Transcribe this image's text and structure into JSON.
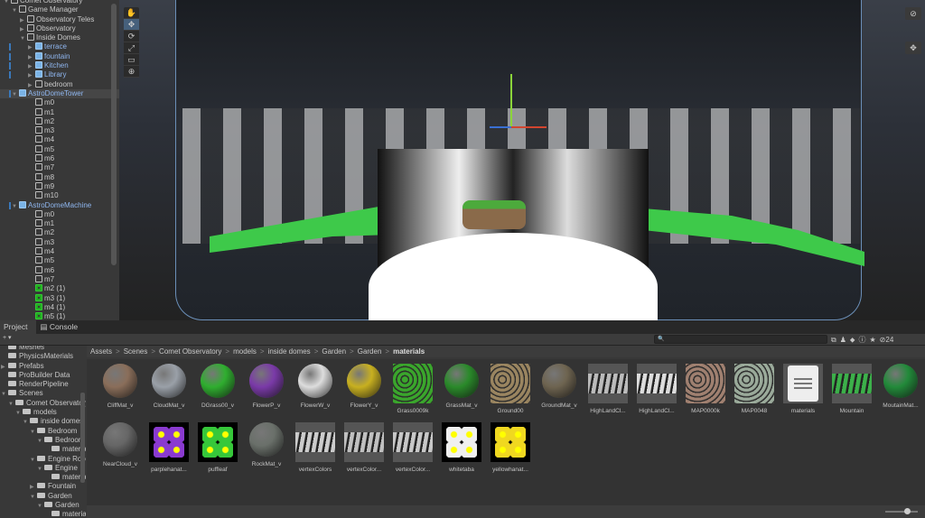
{
  "hierarchy": {
    "items": [
      {
        "label": "Comet Observatory",
        "indent": 0,
        "tri": "▼",
        "type": "scene"
      },
      {
        "label": "Game Manager",
        "indent": 1,
        "tri": "▼",
        "type": "obj"
      },
      {
        "label": "Observatory Teles",
        "indent": 2,
        "tri": "▶",
        "type": "obj"
      },
      {
        "label": "Observatory",
        "indent": 2,
        "tri": "▶",
        "type": "obj"
      },
      {
        "label": "Inside Domes",
        "indent": 2,
        "tri": "▼",
        "type": "obj"
      },
      {
        "label": "terrace",
        "indent": 3,
        "tri": "▶",
        "type": "prefab"
      },
      {
        "label": "fountain",
        "indent": 3,
        "tri": "▶",
        "type": "prefab"
      },
      {
        "label": "Kitchen",
        "indent": 3,
        "tri": "▶",
        "type": "prefab"
      },
      {
        "label": "Library",
        "indent": 3,
        "tri": "▶",
        "type": "prefab"
      },
      {
        "label": "bedroom",
        "indent": 3,
        "tri": "▶",
        "type": "obj"
      },
      {
        "label": "AstroDomeTower",
        "indent": 1,
        "tri": "▼",
        "type": "prefab",
        "sel": true
      },
      {
        "label": "m0",
        "indent": 3,
        "type": "obj"
      },
      {
        "label": "m1",
        "indent": 3,
        "type": "obj"
      },
      {
        "label": "m2",
        "indent": 3,
        "type": "obj"
      },
      {
        "label": "m3",
        "indent": 3,
        "type": "obj"
      },
      {
        "label": "m4",
        "indent": 3,
        "type": "obj"
      },
      {
        "label": "m5",
        "indent": 3,
        "type": "obj"
      },
      {
        "label": "m6",
        "indent": 3,
        "type": "obj"
      },
      {
        "label": "m7",
        "indent": 3,
        "type": "obj"
      },
      {
        "label": "m8",
        "indent": 3,
        "type": "obj"
      },
      {
        "label": "m9",
        "indent": 3,
        "type": "obj"
      },
      {
        "label": "m10",
        "indent": 3,
        "type": "obj"
      },
      {
        "label": "AstroDomeMachine",
        "indent": 1,
        "tri": "▼",
        "type": "prefab"
      },
      {
        "label": "m0",
        "indent": 3,
        "type": "obj"
      },
      {
        "label": "m1",
        "indent": 3,
        "type": "obj"
      },
      {
        "label": "m2",
        "indent": 3,
        "type": "obj"
      },
      {
        "label": "m3",
        "indent": 3,
        "type": "obj"
      },
      {
        "label": "m4",
        "indent": 3,
        "type": "obj"
      },
      {
        "label": "m5",
        "indent": 3,
        "type": "obj"
      },
      {
        "label": "m6",
        "indent": 3,
        "type": "obj"
      },
      {
        "label": "m7",
        "indent": 3,
        "type": "obj"
      },
      {
        "label": "m2 (1)",
        "indent": 3,
        "type": "added"
      },
      {
        "label": "m3 (1)",
        "indent": 3,
        "type": "added"
      },
      {
        "label": "m4 (1)",
        "indent": 3,
        "type": "added"
      },
      {
        "label": "m5 (1)",
        "indent": 3,
        "type": "added"
      }
    ]
  },
  "scene_tools": [
    "✋",
    "✥",
    "⟳",
    "⤢",
    "▭",
    "⊕"
  ],
  "tabs": [
    {
      "label": "Project",
      "icon": "folder-icon"
    },
    {
      "label": "Console",
      "icon": "console-icon"
    }
  ],
  "search": {
    "placeholder": "🔍"
  },
  "hidden_count": "24",
  "tree": [
    {
      "label": "Meshes",
      "indent": 0
    },
    {
      "label": "PhysicsMaterials",
      "indent": 0
    },
    {
      "label": "Prefabs",
      "indent": 0,
      "tri": "▶"
    },
    {
      "label": "ProBuilder Data",
      "indent": 0
    },
    {
      "label": "RenderPipeline",
      "indent": 0
    },
    {
      "label": "Scenes",
      "indent": 0,
      "tri": "▼"
    },
    {
      "label": "Comet Observatory",
      "indent": 1,
      "tri": "▼"
    },
    {
      "label": "models",
      "indent": 2,
      "tri": "▼"
    },
    {
      "label": "inside domes",
      "indent": 3,
      "tri": "▼"
    },
    {
      "label": "Bedroom",
      "indent": 4,
      "tri": "▼"
    },
    {
      "label": "Bedroom",
      "indent": 5,
      "tri": "▼"
    },
    {
      "label": "materials",
      "indent": 6
    },
    {
      "label": "Engine Room",
      "indent": 4,
      "tri": "▼"
    },
    {
      "label": "Engine",
      "indent": 5,
      "tri": "▼"
    },
    {
      "label": "materials",
      "indent": 6
    },
    {
      "label": "Fountain",
      "indent": 4,
      "tri": "▶"
    },
    {
      "label": "Garden",
      "indent": 4,
      "tri": "▼"
    },
    {
      "label": "Garden",
      "indent": 5,
      "tri": "▼"
    },
    {
      "label": "materials",
      "indent": 6
    }
  ],
  "breadcrumb": [
    "Assets",
    "Scenes",
    "Comet Observatory",
    "models",
    "inside domes",
    "Garden",
    "Garden",
    "materials"
  ],
  "assets": [
    {
      "label": "CliffMat_v",
      "kind": "sphere",
      "color": "#8a6e5a"
    },
    {
      "label": "CloudMat_v",
      "kind": "sphere",
      "color": "#9aa0a8"
    },
    {
      "label": "DGrass00_v",
      "kind": "sphere",
      "color": "#2fae2f"
    },
    {
      "label": "FlowerP_v",
      "kind": "sphere",
      "color": "#7a3aa8"
    },
    {
      "label": "FlowerW_v",
      "kind": "sphere",
      "color": "#dddddd"
    },
    {
      "label": "FlowerY_v",
      "kind": "sphere",
      "color": "#c8b020"
    },
    {
      "label": "Grass0009k",
      "kind": "tex",
      "color": "#3aa62c"
    },
    {
      "label": "GrassMat_v",
      "kind": "sphere",
      "color": "#2a8a2a"
    },
    {
      "label": "Ground00",
      "kind": "tex",
      "color": "#9a8560"
    },
    {
      "label": "GroundMat_v",
      "kind": "sphere",
      "color": "#6e6450"
    },
    {
      "label": "HighLandCl...",
      "kind": "wide",
      "color": "#bbbbbb"
    },
    {
      "label": "HighLandCl...",
      "kind": "wide",
      "color": "#dddddd"
    },
    {
      "label": "MAP0000k",
      "kind": "tex",
      "color": "#a08070"
    },
    {
      "label": "MAP0048",
      "kind": "tex",
      "color": "#9aaa9a"
    },
    {
      "label": "materials",
      "kind": "doc",
      "color": "#eeeeee"
    },
    {
      "label": "Mountain",
      "kind": "wide",
      "color": "#3cb04a"
    },
    {
      "label": "MoutainMat...",
      "kind": "sphere",
      "color": "#228a3a"
    },
    {
      "label": "NearCloud_v",
      "kind": "sphere",
      "color": "#666666"
    },
    {
      "label": "parplehanat...",
      "kind": "img",
      "color": "#8a3ad0"
    },
    {
      "label": "puffleaf",
      "kind": "img",
      "color": "#36c83a"
    },
    {
      "label": "RockMat_v",
      "kind": "sphere",
      "color": "#6a706a"
    },
    {
      "label": "vertexColors",
      "kind": "wide",
      "color": "#cccccc"
    },
    {
      "label": "vertexColor...",
      "kind": "wide",
      "color": "#c0c0c0"
    },
    {
      "label": "vertexColor...",
      "kind": "wide",
      "color": "#c8c8c8"
    },
    {
      "label": "whitetaba",
      "kind": "img",
      "color": "#f0f0f0"
    },
    {
      "label": "yellowhanat...",
      "kind": "img",
      "color": "#f0d820"
    }
  ]
}
